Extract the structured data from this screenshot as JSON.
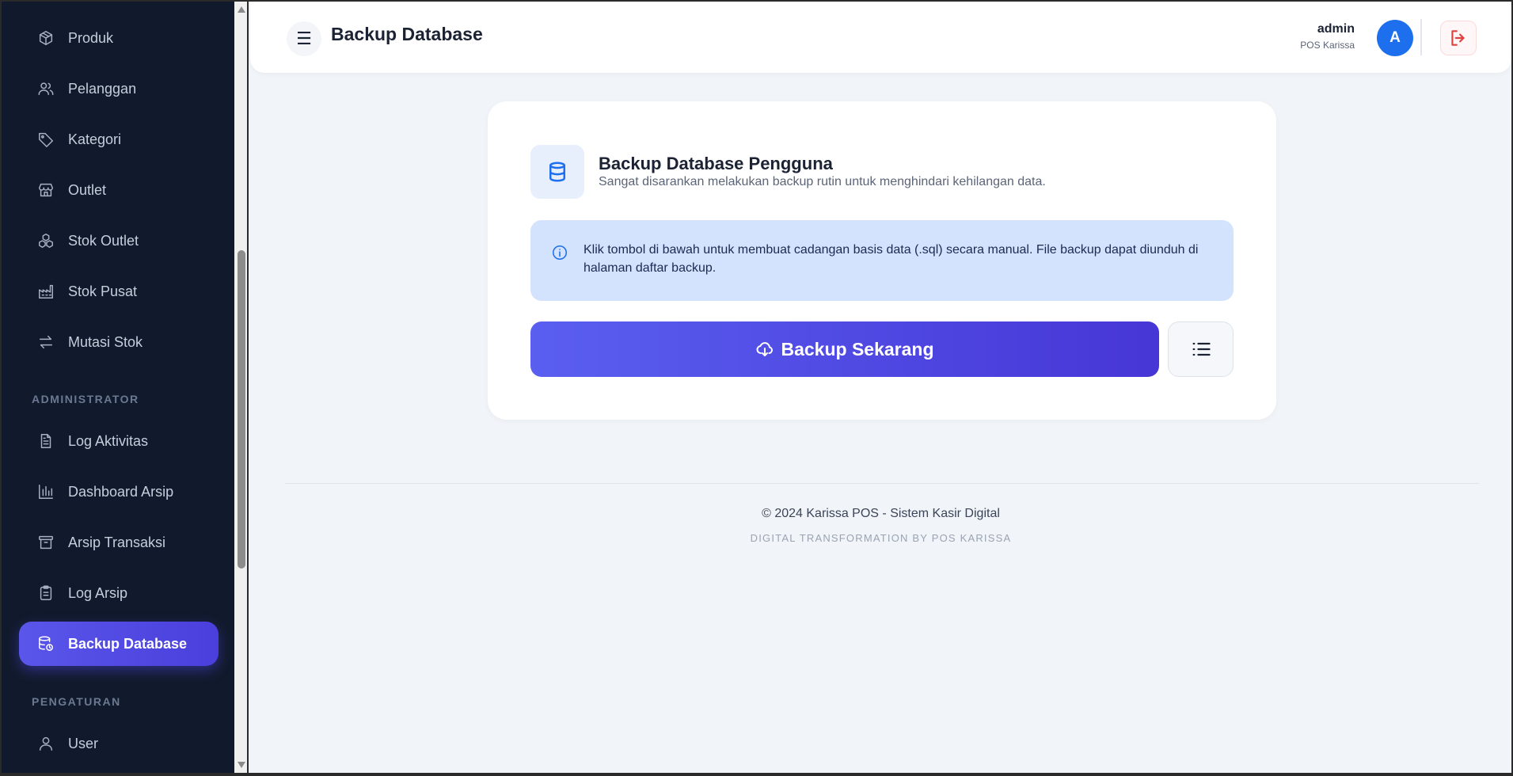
{
  "sidebar": {
    "items": [
      {
        "label": "Produk",
        "icon": "package-icon"
      },
      {
        "label": "Pelanggan",
        "icon": "users-icon"
      },
      {
        "label": "Kategori",
        "icon": "tag-icon"
      },
      {
        "label": "Outlet",
        "icon": "store-icon"
      },
      {
        "label": "Stok Outlet",
        "icon": "boxes-icon"
      },
      {
        "label": "Stok Pusat",
        "icon": "factory-icon"
      },
      {
        "label": "Mutasi Stok",
        "icon": "arrows-exchange-icon"
      }
    ],
    "section_admin": "ADMINISTRATOR",
    "admin_items": [
      {
        "label": "Log Aktivitas",
        "icon": "file-text-icon"
      },
      {
        "label": "Dashboard Arsip",
        "icon": "bar-chart-icon"
      },
      {
        "label": "Arsip Transaksi",
        "icon": "archive-icon"
      },
      {
        "label": "Log Arsip",
        "icon": "clipboard-icon"
      },
      {
        "label": "Backup Database",
        "icon": "database-backup-icon",
        "active": true
      }
    ],
    "section_settings": "PENGATURAN",
    "settings_items": [
      {
        "label": "User",
        "icon": "user-icon"
      }
    ]
  },
  "header": {
    "menu_icon": "☰",
    "title": "Backup Database",
    "user_name": "admin",
    "user_role": "POS Karissa",
    "avatar_initial": "A"
  },
  "card": {
    "title": "Backup Database Pengguna",
    "subtitle": "Sangat disarankan melakukan backup rutin untuk menghindari kehilangan data.",
    "info": "Klik tombol di bawah untuk membuat cadangan basis data (.sql) secara manual. File backup dapat diunduh di halaman daftar backup.",
    "backup_button": "Backup Sekarang"
  },
  "footer": {
    "copyright": "© 2024 Karissa POS - Sistem Kasir Digital",
    "tagline": "DIGITAL TRANSFORMATION BY POS KARISSA"
  },
  "colors": {
    "sidebar_bg": "#111a2c",
    "accent": "#4f46e5",
    "primary_blue": "#1e6fed",
    "danger": "#e0403f"
  }
}
